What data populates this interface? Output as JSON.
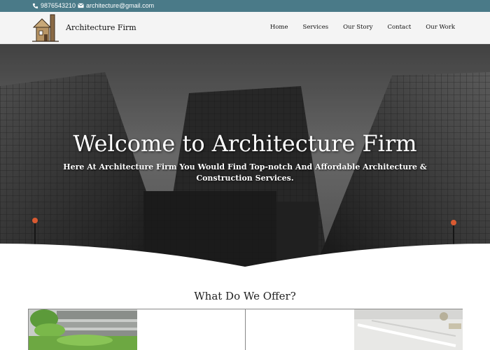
{
  "topbar": {
    "phone": "9876543210",
    "email": "architecture@gmail.com",
    "phone_icon": "phone-icon",
    "email_icon": "envelope-icon"
  },
  "header": {
    "brand": "Architecture Firm",
    "logo_icon": "house-logo"
  },
  "nav": {
    "items": [
      "Home",
      "Services",
      "Our Story",
      "Contact",
      "Our Work"
    ]
  },
  "hero": {
    "title": "Welcome to Architecture Firm",
    "subtitle": "Here At Architecture Firm You Would Find Top-notch And Affordable Architecture & Construction Services."
  },
  "offer": {
    "title": "What Do We Offer?"
  },
  "colors": {
    "topbar_bg": "#4a7a88",
    "header_bg": "#f4f4f4",
    "hero_sky": "#6b6b6b"
  }
}
